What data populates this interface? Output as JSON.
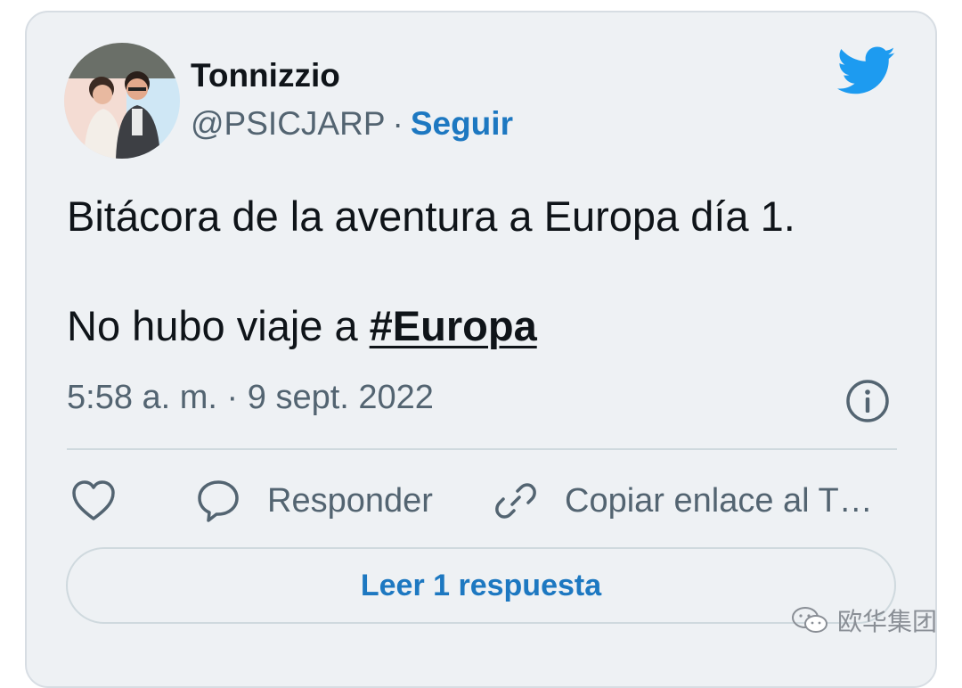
{
  "tweet": {
    "author_name": "Tonnizzio",
    "handle": "@PSICJARP",
    "separator": "·",
    "follow_label": "Seguir",
    "text_line1": "Bitácora de la aventura a Europa día 1.",
    "text_line2_prefix": "No hubo viaje a ",
    "hashtag": "#Europa",
    "timestamp": "5:58 a. m. · 9 sept. 2022"
  },
  "actions": {
    "like_icon": "heart-icon",
    "reply_label": "Responder",
    "copy_link_label": "Copiar enlace al T…"
  },
  "read_replies_label": "Leer 1 respuesta",
  "watermark_text": "欧华集团",
  "colors": {
    "card_bg": "#eef1f4",
    "accent": "#1d78c1",
    "twitter_blue": "#1d9bf0",
    "text_primary": "#0f1419",
    "text_secondary": "#536471"
  }
}
